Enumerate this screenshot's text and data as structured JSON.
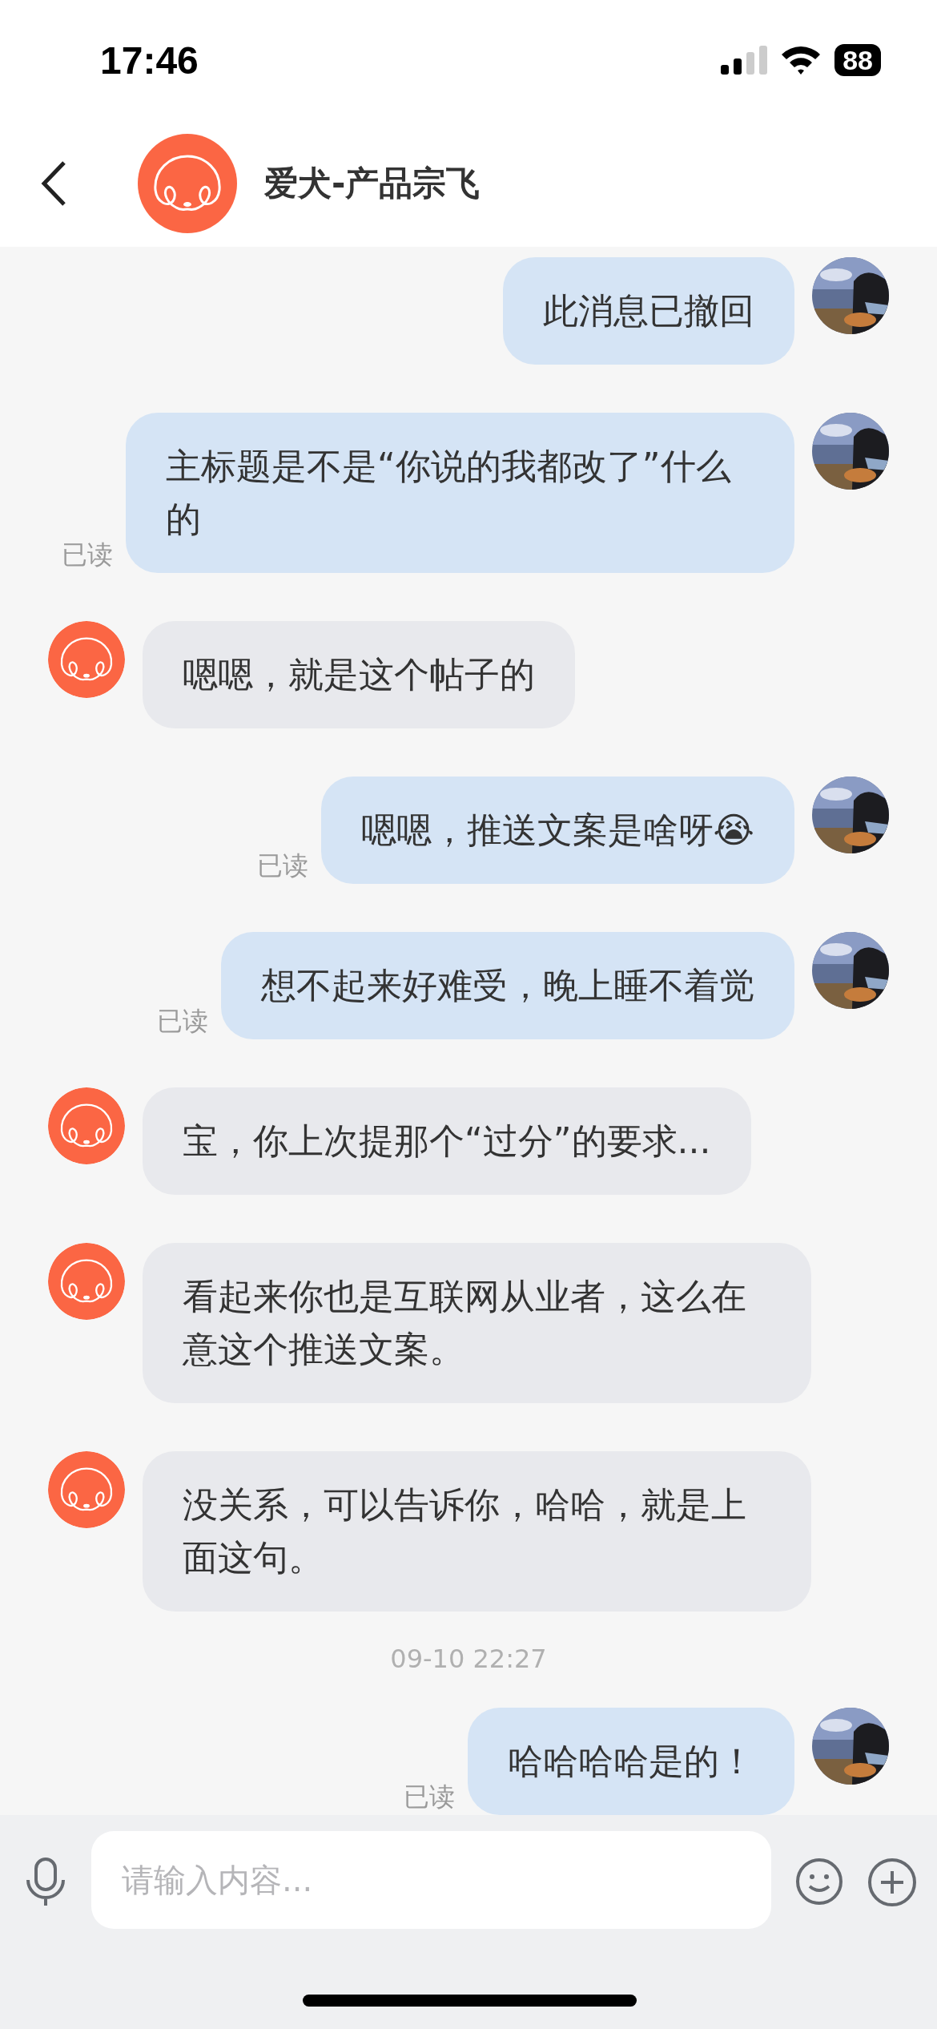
{
  "status_bar": {
    "time": "17:46",
    "battery": "88"
  },
  "header": {
    "title": "爱犬-产品宗飞"
  },
  "messages": [
    {
      "kind": "bubble",
      "outgoing": true,
      "text": "此消息已撤回"
    },
    {
      "kind": "bubble",
      "outgoing": true,
      "text": "主标题是不是“你说的我都改了”什么的",
      "read_label": "已读"
    },
    {
      "kind": "bubble",
      "outgoing": false,
      "text": "嗯嗯，就是这个帖子的"
    },
    {
      "kind": "bubble",
      "outgoing": true,
      "text": "嗯嗯，推送文案是啥呀😭",
      "read_label": "已读"
    },
    {
      "kind": "bubble",
      "outgoing": true,
      "text": "想不起来好难受，晚上睡不着觉",
      "read_label": "已读"
    },
    {
      "kind": "bubble",
      "outgoing": false,
      "text": "宝，你上次提那个“过分”的要求..."
    },
    {
      "kind": "bubble",
      "outgoing": false,
      "text": "看起来你也是互联网从业者，这么在意这个推送文案。"
    },
    {
      "kind": "bubble",
      "outgoing": false,
      "text": "没关系，可以告诉你，哈哈，就是上面这句。"
    },
    {
      "kind": "time",
      "text": "09-10 22:27"
    },
    {
      "kind": "bubble",
      "outgoing": true,
      "text": "哈哈哈哈是的！",
      "read_label": "已读"
    }
  ],
  "input": {
    "placeholder": "请输入内容..."
  }
}
